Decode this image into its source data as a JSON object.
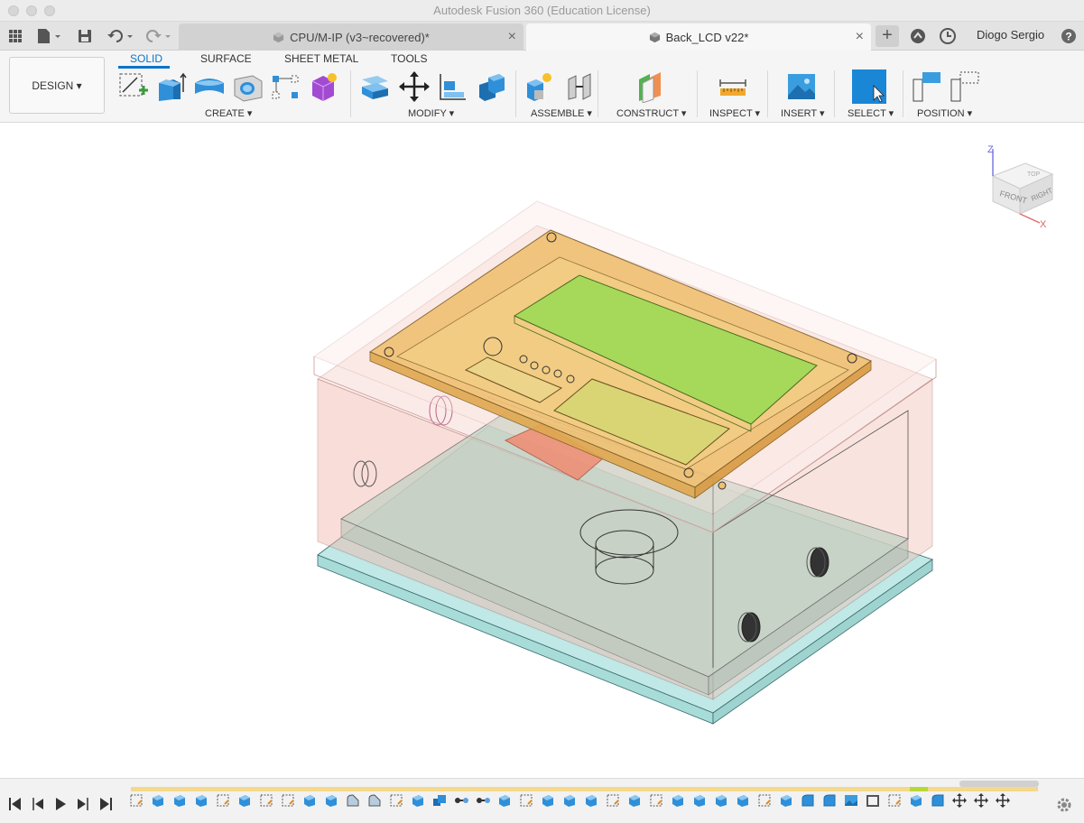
{
  "window": {
    "title": "Autodesk Fusion 360 (Education License)"
  },
  "tabs": [
    {
      "label": "CPU/M-IP (v3~recovered)*",
      "active": false
    },
    {
      "label": "Back_LCD v22*",
      "active": true
    }
  ],
  "user": {
    "name": "Diogo Sergio"
  },
  "toolbar": {
    "design_label": "DESIGN ▾",
    "workspace_tabs": [
      "SOLID",
      "SURFACE",
      "SHEET METAL",
      "TOOLS"
    ],
    "groups": {
      "create": "CREATE ▾",
      "modify": "MODIFY ▾",
      "assemble": "ASSEMBLE ▾",
      "construct": "CONSTRUCT ▾",
      "inspect": "INSPECT ▾",
      "insert": "INSERT ▾",
      "select": "SELECT ▾",
      "position": "POSITION ▾"
    }
  },
  "viewcube": {
    "top": "TOP",
    "front": "FRONT",
    "right": "RIGHT",
    "z": "Z",
    "x": "X"
  },
  "help": "?",
  "colors": {
    "accent": "#0a74c7",
    "lcd_green": "#a6d95a",
    "pcb_orange": "#f0c070",
    "enclosure_pink": "#f7c9c0",
    "base_cyan": "#bfe8e6"
  }
}
